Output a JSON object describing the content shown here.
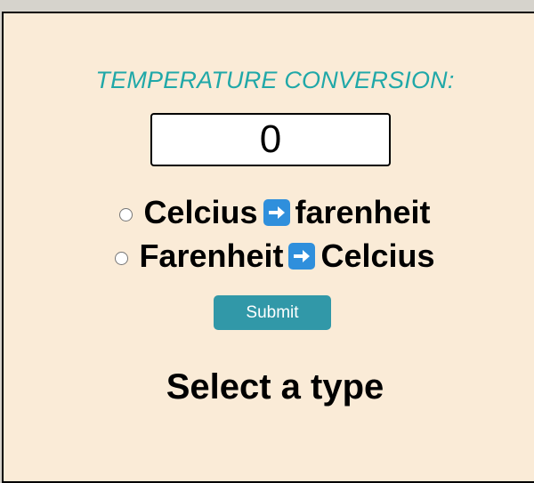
{
  "converter": {
    "title": "TEMPERATURE CONVERSION:",
    "input_value": "0",
    "options": [
      {
        "from": "Celcius",
        "to": "farenheit",
        "arrow_icon": "right-arrow-icon"
      },
      {
        "from": "Farenheit",
        "to": "Celcius",
        "arrow_icon": "right-arrow-icon"
      }
    ],
    "submit_label": "Submit",
    "result_text": "Select a type"
  },
  "colors": {
    "title": "#20a8a8",
    "panel_background": "#faebd7",
    "submit_background": "#3198a8",
    "arrow_icon_background": "#2f8fdc"
  }
}
